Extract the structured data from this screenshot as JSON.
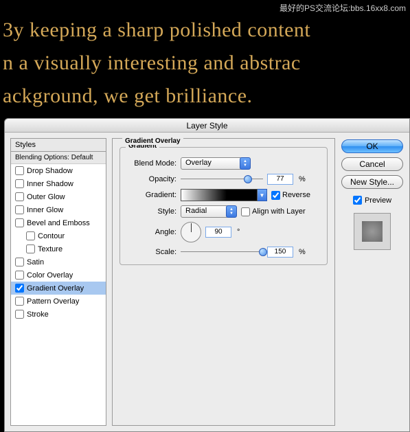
{
  "watermark": "最好的PS交流论坛:bbs.16xx8.com",
  "bgText": "3y keeping a sharp polished content\nn a visually interesting and abstrac\nackground, we get brilliance.",
  "dialog": {
    "title": "Layer Style"
  },
  "stylesPanel": {
    "header": "Styles",
    "sub": "Blending Options: Default",
    "items": [
      {
        "label": "Drop Shadow",
        "checked": false
      },
      {
        "label": "Inner Shadow",
        "checked": false
      },
      {
        "label": "Outer Glow",
        "checked": false
      },
      {
        "label": "Inner Glow",
        "checked": false
      },
      {
        "label": "Bevel and Emboss",
        "checked": false
      },
      {
        "label": "Contour",
        "checked": false,
        "indent": true
      },
      {
        "label": "Texture",
        "checked": false,
        "indent": true
      },
      {
        "label": "Satin",
        "checked": false
      },
      {
        "label": "Color Overlay",
        "checked": false
      },
      {
        "label": "Gradient Overlay",
        "checked": true,
        "selected": true
      },
      {
        "label": "Pattern Overlay",
        "checked": false
      },
      {
        "label": "Stroke",
        "checked": false
      }
    ]
  },
  "gradientOverlay": {
    "sectionTitle": "Gradient Overlay",
    "groupTitle": "Gradient",
    "blendModeLabel": "Blend Mode:",
    "blendMode": "Overlay",
    "opacityLabel": "Opacity:",
    "opacity": "77",
    "gradientLabel": "Gradient:",
    "reverseLabel": "Reverse",
    "reverse": true,
    "styleLabel": "Style:",
    "style": "Radial",
    "alignLabel": "Align with Layer",
    "align": false,
    "angleLabel": "Angle:",
    "angle": "90",
    "scaleLabel": "Scale:",
    "scale": "150",
    "pct": "%",
    "deg": "°"
  },
  "buttons": {
    "ok": "OK",
    "cancel": "Cancel",
    "newStyle": "New Style...",
    "preview": "Preview"
  }
}
